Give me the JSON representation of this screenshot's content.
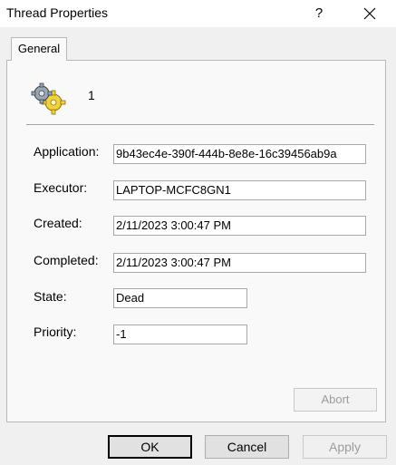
{
  "window": {
    "title": "Thread Properties",
    "help_label": "?",
    "close_icon": "close-icon"
  },
  "tabs": [
    {
      "label": "General",
      "selected": true
    }
  ],
  "header": {
    "icon": "gears-icon",
    "thread_id": "1"
  },
  "fields": {
    "application": {
      "label": "Application:",
      "value": "9b43ec4e-390f-444b-8e8e-16c39456ab9a"
    },
    "executor": {
      "label": "Executor:",
      "value": "LAPTOP-MCFC8GN1"
    },
    "created": {
      "label": "Created:",
      "value": "2/11/2023 3:00:47 PM"
    },
    "completed": {
      "label": "Completed:",
      "value": "2/11/2023 3:00:47 PM"
    },
    "state": {
      "label": "State:",
      "value": "Dead"
    },
    "priority": {
      "label": "Priority:",
      "value": "-1"
    }
  },
  "buttons": {
    "abort": "Abort",
    "ok": "OK",
    "cancel": "Cancel",
    "apply": "Apply"
  }
}
